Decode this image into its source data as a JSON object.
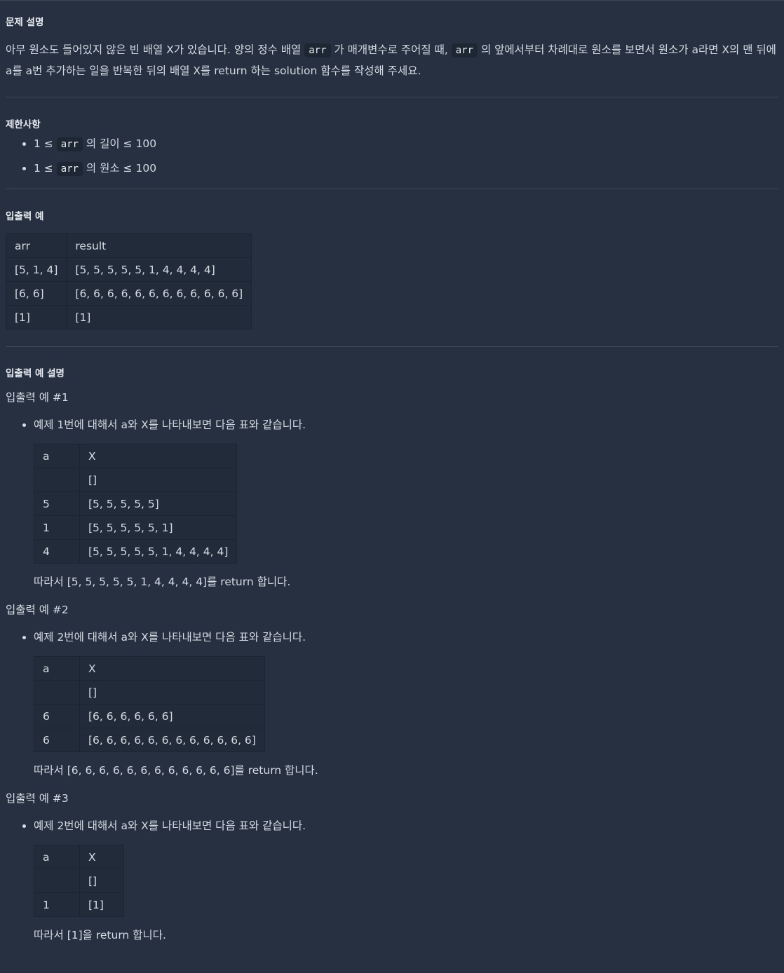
{
  "sections": {
    "description_title": "문제 설명",
    "constraints_title": "제한사항",
    "io_title": "입출력 예",
    "explain_title": "입출력 예 설명"
  },
  "description": {
    "part1": "아무 원소도 들어있지 않은 빈 배열 X가 있습니다. 양의 정수 배열 ",
    "code1": "arr",
    "part2": " 가 매개변수로 주어질 때, ",
    "code2": "arr",
    "part3": " 의 앞에서부터 차례대로 원소를 보면서 원소가 a라면 X의 맨 뒤에 a를 a번 추가하는 일을 반복한 뒤의 배열 X를 return 하는 solution 함수를 작성해 주세요.",
    "line1_tail": " 의 앞에서부터 차례대로 원소를 보면서 원소가 a라면 X의 맨 뒤에",
    "line2": "a를 a번 추가하는 일을 반복한 뒤의 배열 X를 return 하는 solution 함수를 작성해 주세요."
  },
  "constraints": [
    {
      "pre": "1 ≤ ",
      "code": "arr",
      "post": " 의 길이 ≤ 100"
    },
    {
      "pre": "1 ≤ ",
      "code": "arr",
      "post": " 의 원소 ≤ 100"
    }
  ],
  "io_table": {
    "headers": [
      "arr",
      "result"
    ],
    "rows": [
      [
        "[5, 1, 4]",
        "[5, 5, 5, 5, 5, 1, 4, 4, 4, 4]"
      ],
      [
        "[6, 6]",
        "[6, 6, 6, 6, 6, 6, 6, 6, 6, 6, 6, 6]"
      ],
      [
        "[1]",
        "[1]"
      ]
    ]
  },
  "examples": [
    {
      "title": "입출력 예 #1",
      "bullet": "예제 1번에 대해서 a와 X를 나타내보면 다음 표와 같습니다.",
      "headers": [
        "a",
        "X"
      ],
      "rows": [
        [
          "",
          "[]"
        ],
        [
          "5",
          "[5, 5, 5, 5, 5]"
        ],
        [
          "1",
          "[5, 5, 5, 5, 5, 1]"
        ],
        [
          "4",
          "[5, 5, 5, 5, 5, 1, 4, 4, 4, 4]"
        ]
      ],
      "conclusion": "따라서 [5, 5, 5, 5, 5, 1, 4, 4, 4, 4]를 return 합니다."
    },
    {
      "title": "입출력 예 #2",
      "bullet": "예제 2번에 대해서 a와 X를 나타내보면 다음 표와 같습니다.",
      "headers": [
        "a",
        "X"
      ],
      "rows": [
        [
          "",
          "[]"
        ],
        [
          "6",
          "[6, 6, 6, 6, 6, 6]"
        ],
        [
          "6",
          "[6, 6, 6, 6, 6, 6, 6, 6, 6, 6, 6, 6]"
        ]
      ],
      "conclusion": "따라서 [6, 6, 6, 6, 6, 6, 6, 6, 6, 6, 6, 6]를 return 합니다."
    },
    {
      "title": "입출력 예 #3",
      "bullet": "예제 2번에 대해서 a와 X를 나타내보면 다음 표와 같습니다.",
      "headers": [
        "a",
        "X"
      ],
      "rows": [
        [
          "",
          "[]"
        ],
        [
          "1",
          "[1]"
        ]
      ],
      "conclusion": "따라서 [1]을 return 합니다."
    }
  ]
}
